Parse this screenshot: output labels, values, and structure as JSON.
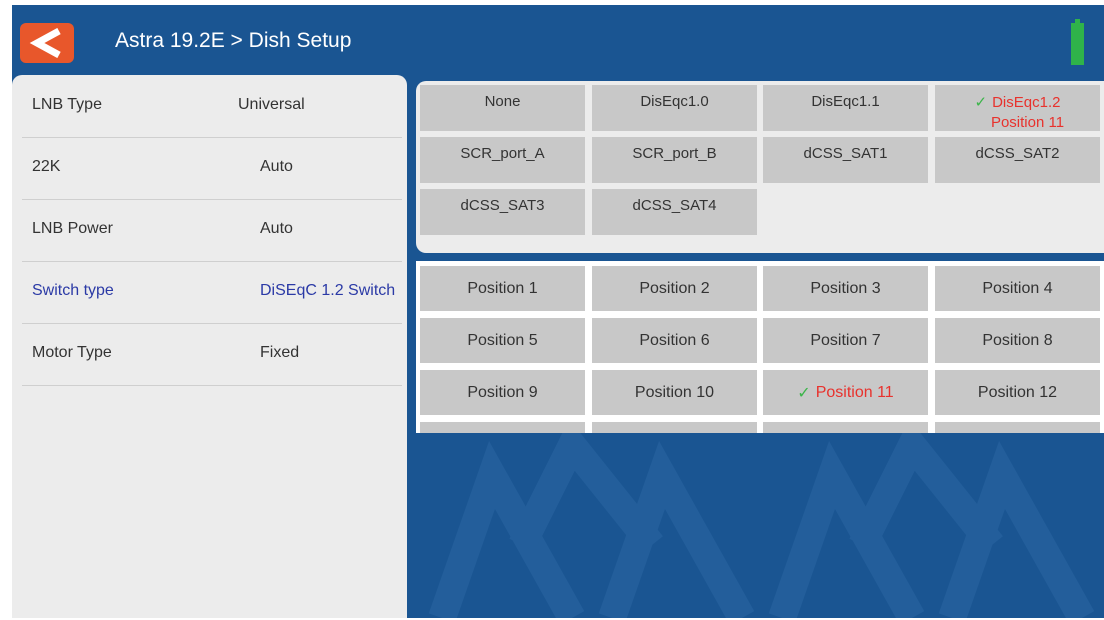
{
  "header": {
    "title": "Astra 19.2E > Dish Setup",
    "back_icon": "chevron-left-icon",
    "battery_icon": "battery-full-icon",
    "accent_color": "#e8572b",
    "battery_color": "#2fb34a"
  },
  "settings": [
    {
      "label": "LNB Type",
      "value": "Universal"
    },
    {
      "label": "22K",
      "value": "Auto"
    },
    {
      "label": "LNB Power",
      "value": "Auto"
    },
    {
      "label": "Switch type",
      "value": "DiSEqC 1.2 Switch"
    },
    {
      "label": "Motor Type",
      "value": "Fixed"
    }
  ],
  "switch_options": [
    {
      "label": "None"
    },
    {
      "label": "DisEqc1.0"
    },
    {
      "label": "DisEqc1.1"
    },
    {
      "label": "DisEqc1.2",
      "sublabel": "Position 11"
    },
    {
      "label": "SCR_port_A"
    },
    {
      "label": "SCR_port_B"
    },
    {
      "label": "dCSS_SAT1"
    },
    {
      "label": "dCSS_SAT2"
    },
    {
      "label": "dCSS_SAT3"
    },
    {
      "label": "dCSS_SAT4"
    }
  ],
  "positions": [
    {
      "label": "Position 1"
    },
    {
      "label": "Position 2"
    },
    {
      "label": "Position 3"
    },
    {
      "label": "Position 4"
    },
    {
      "label": "Position 5"
    },
    {
      "label": "Position 6"
    },
    {
      "label": "Position 7"
    },
    {
      "label": "Position 8"
    },
    {
      "label": "Position 9"
    },
    {
      "label": "Position 10"
    },
    {
      "label": "Position 11"
    },
    {
      "label": "Position 12"
    }
  ],
  "selected": {
    "setting": "Switch type",
    "switch": "DisEqc1.2",
    "position": "Position 11"
  },
  "colors": {
    "background": "#1a5592",
    "selected_text": "#e8322d",
    "check": "#3cb54a",
    "active_setting": "#2b3aa6"
  }
}
